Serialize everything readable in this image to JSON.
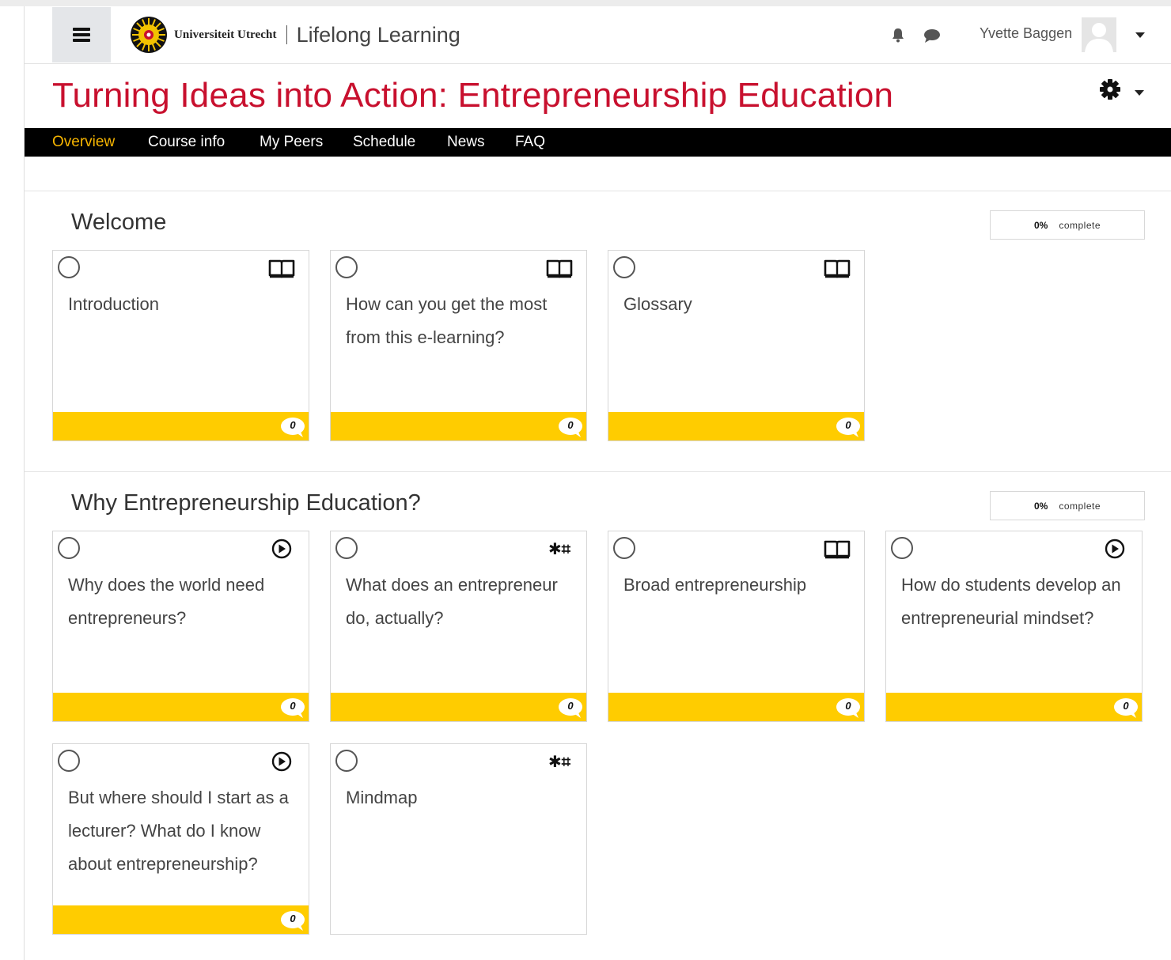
{
  "navbar": {
    "university": "Universiteit Utrecht",
    "site_name": "Lifelong Learning",
    "user_name": "Yvette Baggen",
    "icons": [
      "menu-icon",
      "bell-icon",
      "chat-icon",
      "avatar-icon",
      "caret-down-icon"
    ]
  },
  "course": {
    "title": "Turning Ideas into Action: Entrepreneurship Education",
    "title_color": "#c8102e",
    "settings_icon": "gear-icon"
  },
  "tabs": [
    {
      "label": "Overview",
      "active": true
    },
    {
      "label": "Course info",
      "active": false
    },
    {
      "label": "My Peers",
      "active": false
    },
    {
      "label": "Schedule",
      "active": false
    },
    {
      "label": "News",
      "active": false
    },
    {
      "label": "FAQ",
      "active": false
    }
  ],
  "colors": {
    "accent": "#ffcc00",
    "active_tab": "#f7b500",
    "tab_bar": "#000000"
  },
  "sections": [
    {
      "title": "Welcome",
      "progress": {
        "percent": "0%",
        "label": "complete"
      },
      "activities": [
        {
          "title": "Introduction",
          "icon": "book-icon",
          "comments": "0"
        },
        {
          "title": "How can you get the most from this e-learning?",
          "icon": "book-icon",
          "comments": "0"
        },
        {
          "title": "Glossary",
          "icon": "book-icon",
          "comments": "0"
        }
      ]
    },
    {
      "title": "Why Entrepreneurship Education?",
      "progress": {
        "percent": "0%",
        "label": "complete"
      },
      "activities": [
        {
          "title": "Why does the world need entrepreneurs?",
          "icon": "play-icon",
          "comments": "0"
        },
        {
          "title": "What does an entrepreneur do, actually?",
          "icon": "puzzle-icon",
          "comments": "0"
        },
        {
          "title": "Broad entrepreneurship",
          "icon": "book-icon",
          "comments": "0"
        },
        {
          "title": "How do students develop an entrepreneurial mindset?",
          "icon": "play-icon",
          "comments": "0"
        },
        {
          "title": "But where should I start as a lecturer? What do I know about entrepreneurship?",
          "icon": "play-icon",
          "comments": "0"
        },
        {
          "title": "Mindmap",
          "icon": "puzzle-icon"
        }
      ]
    }
  ]
}
